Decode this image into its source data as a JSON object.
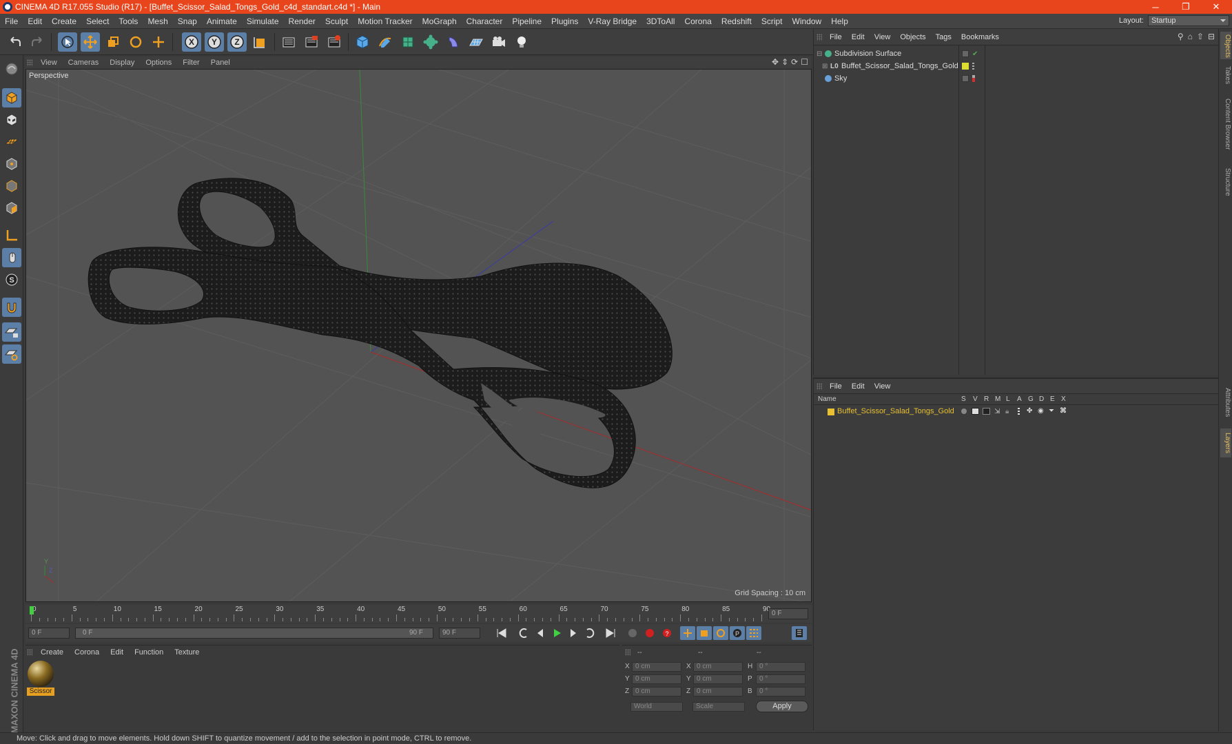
{
  "window": {
    "title": "CINEMA 4D R17.055 Studio (R17) - [Buffet_Scissor_Salad_Tongs_Gold_c4d_standart.c4d *] - Main",
    "minimize": "─",
    "restore": "❐",
    "close": "✕"
  },
  "menubar": {
    "items": [
      "File",
      "Edit",
      "Create",
      "Select",
      "Tools",
      "Mesh",
      "Snap",
      "Animate",
      "Simulate",
      "Render",
      "Sculpt",
      "Motion Tracker",
      "MoGraph",
      "Character",
      "Pipeline",
      "Plugins",
      "V-Ray Bridge",
      "3DToAll",
      "Corona",
      "Redshift",
      "Script",
      "Window",
      "Help"
    ],
    "layout_label": "Layout:",
    "layout_value": "Startup"
  },
  "viewport": {
    "menu": [
      "View",
      "Cameras",
      "Display",
      "Options",
      "Filter",
      "Panel"
    ],
    "camera_label": "Perspective",
    "grid_spacing": "Grid Spacing : 10 cm"
  },
  "timeline": {
    "ticks": [
      "0",
      "5",
      "10",
      "15",
      "20",
      "25",
      "30",
      "35",
      "40",
      "45",
      "50",
      "55",
      "60",
      "65",
      "70",
      "75",
      "80",
      "85",
      "90"
    ],
    "current_frame": "0 F",
    "start_field": "0 F",
    "range_start": "0 F",
    "range_end": "90 F",
    "end_field": "90 F"
  },
  "material_panel": {
    "menu": [
      "Create",
      "Corona",
      "Edit",
      "Function",
      "Texture"
    ],
    "materials": [
      {
        "name": "Scissor"
      }
    ]
  },
  "coordinates": {
    "headers": [
      "--",
      "--",
      "--"
    ],
    "rows": [
      {
        "a_label": "X",
        "a_val": "0 cm",
        "b_label": "X",
        "b_val": "0 cm",
        "c_label": "H",
        "c_val": "0 °"
      },
      {
        "a_label": "Y",
        "a_val": "0 cm",
        "b_label": "Y",
        "b_val": "0 cm",
        "c_label": "P",
        "c_val": "0 °"
      },
      {
        "a_label": "Z",
        "a_val": "0 cm",
        "b_label": "Z",
        "b_val": "0 cm",
        "c_label": "B",
        "c_val": "0 °"
      }
    ],
    "mode_world": "World",
    "mode_scale": "Scale",
    "apply": "Apply"
  },
  "object_manager": {
    "menu": [
      "File",
      "Edit",
      "View",
      "Objects",
      "Tags",
      "Bookmarks"
    ],
    "objects": [
      {
        "name": "Subdivision Surface",
        "color": "#46b08a"
      },
      {
        "name": "Buffet_Scissor_Salad_Tongs_Gold",
        "color": "#dddd30"
      },
      {
        "name": "Sky",
        "color": "#6aa0d8"
      }
    ]
  },
  "layer_manager": {
    "menu": [
      "File",
      "Edit",
      "View"
    ],
    "columns": {
      "name": "Name",
      "flags": [
        "S",
        "V",
        "R",
        "M",
        "L",
        "A",
        "G",
        "D",
        "E",
        "X"
      ]
    },
    "layers": [
      {
        "name": "Buffet_Scissor_Salad_Tongs_Gold",
        "color": "#e8c030"
      }
    ]
  },
  "right_tabs": [
    "Objects",
    "Takes",
    "Content Browser",
    "Structure",
    "Attributes",
    "Layers"
  ],
  "brand": "MAXON CINEMA 4D",
  "status": "Move: Click and drag to move elements. Hold down SHIFT to quantize movement / add to the selection in point mode, CTRL to remove."
}
